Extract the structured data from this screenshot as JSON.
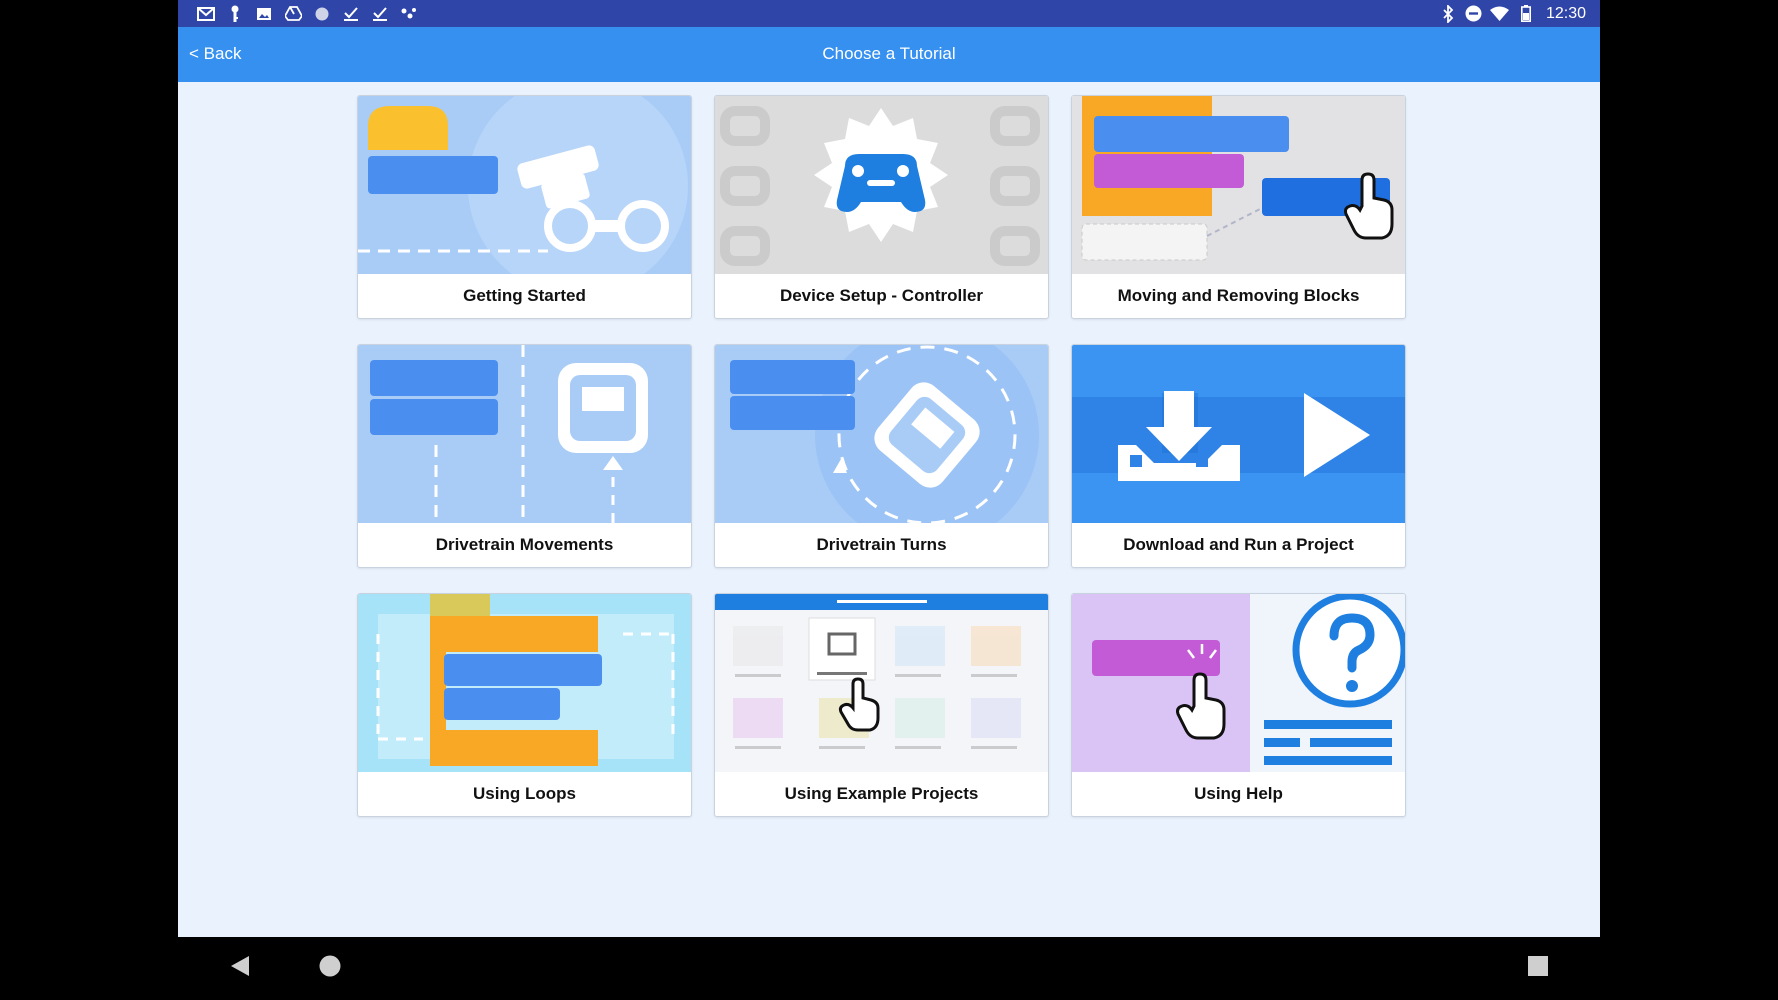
{
  "status_bar": {
    "left_icons": [
      "gmail-icon",
      "key-icon",
      "image-icon",
      "drive-icon",
      "circle-icon",
      "check-icon",
      "check-icon",
      "dots-icon"
    ],
    "right_icons": [
      "bluetooth-icon",
      "do-not-disturb-icon",
      "wifi-icon",
      "battery-icon"
    ],
    "time": "12:30"
  },
  "app_bar": {
    "back_label": "< Back",
    "title": "Choose a Tutorial"
  },
  "tutorials": [
    {
      "label": "Getting Started"
    },
    {
      "label": "Device Setup - Controller"
    },
    {
      "label": "Moving and Removing Blocks"
    },
    {
      "label": "Drivetrain Movements"
    },
    {
      "label": "Drivetrain Turns"
    },
    {
      "label": "Download and Run a Project"
    },
    {
      "label": "Using Loops"
    },
    {
      "label": "Using Example Projects"
    },
    {
      "label": "Using Help"
    }
  ],
  "colors": {
    "status_bar": "#2f46a8",
    "app_bar": "#3590f0",
    "background": "#eaf2fd",
    "block_blue": "#4a8ef0",
    "block_orange": "#f9a825",
    "block_purple": "#c35bd6"
  },
  "nav_bar": {
    "icons": [
      "back-triangle-icon",
      "home-circle-icon",
      "recents-square-icon"
    ]
  }
}
